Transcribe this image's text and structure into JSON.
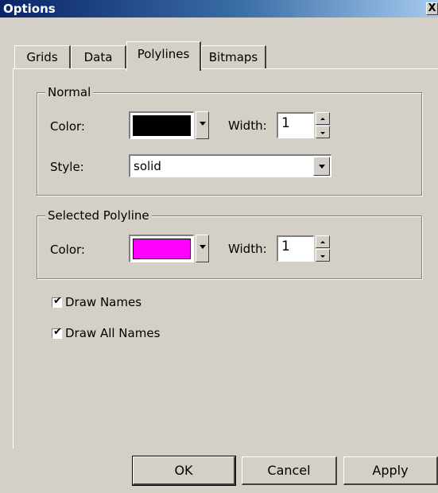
{
  "window": {
    "title": "Options",
    "close_label": "X"
  },
  "tabs": [
    {
      "label": "Grids"
    },
    {
      "label": "Data"
    },
    {
      "label": "Polylines"
    },
    {
      "label": "Bitmaps"
    }
  ],
  "active_tab": "Polylines",
  "normal_group": {
    "title": "Normal",
    "color_label": "Color:",
    "color_value": "#000000",
    "width_label": "Width:",
    "width_value": "1",
    "style_label": "Style:",
    "style_value": "solid"
  },
  "selected_group": {
    "title": "Selected Polyline",
    "color_label": "Color:",
    "color_value": "#ff00ff",
    "width_label": "Width:",
    "width_value": "1"
  },
  "options": [
    {
      "label": "Draw Names",
      "checked": true
    },
    {
      "label": "Draw All Names",
      "checked": true
    }
  ],
  "buttons": {
    "ok": "OK",
    "cancel": "Cancel",
    "apply": "Apply"
  }
}
